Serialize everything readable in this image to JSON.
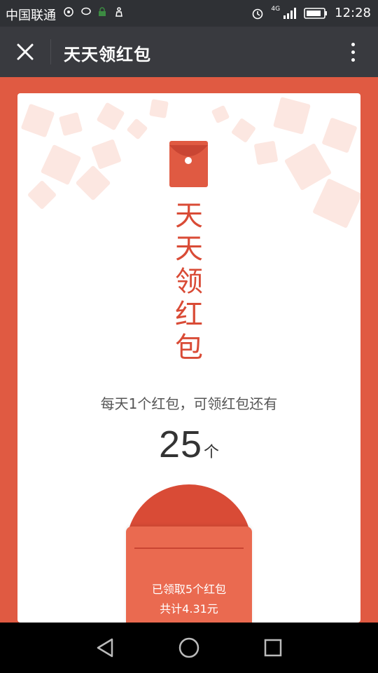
{
  "status_bar": {
    "carrier": "中国联通",
    "network": "4G",
    "time": "12:28"
  },
  "header": {
    "title": "天天领红包",
    "close_icon": "close-icon",
    "more_icon": "more-vertical-icon"
  },
  "main": {
    "vertical_title": [
      "天",
      "天",
      "领",
      "红",
      "包"
    ],
    "daily_text": "每天1个红包，可领红包还有",
    "remaining_count": "25",
    "count_unit": "个",
    "envelope": {
      "received_text": "已领取5个红包",
      "total_text": "共计4.31元"
    }
  },
  "nav_bar": {
    "back_icon": "back-triangle-icon",
    "home_icon": "home-circle-icon",
    "recents_icon": "recents-square-icon"
  },
  "colors": {
    "accent": "#e05a42",
    "title_red": "#d94b36",
    "titlebar_bg": "#393a3f"
  }
}
